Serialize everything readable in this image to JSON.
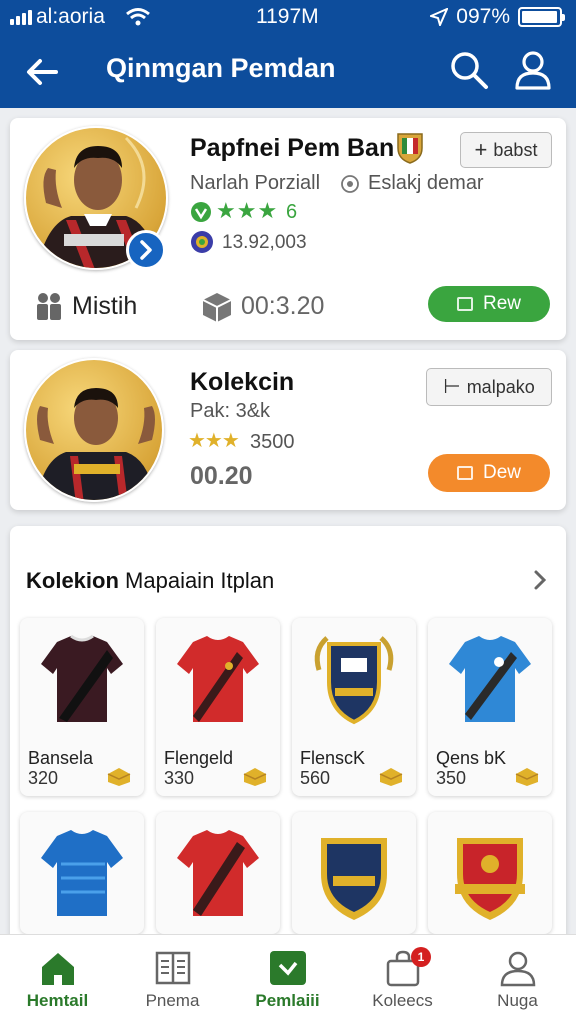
{
  "status_bar": {
    "carrier": "al:aoria",
    "time": "1197M",
    "battery": "097%",
    "battery_level": 0.97
  },
  "app_bar": {
    "title": "Qinmgan Pemdan"
  },
  "player_card": {
    "name": "Papfnei Pem Ban",
    "subtitle": "Narlah Porziall",
    "tag": "Eslakj demar",
    "rating": "6",
    "stars": 3,
    "coins": "13.92,003",
    "action_label": "babst",
    "stat1_label": "Mistih",
    "stat2_value": "00:3.20",
    "primary_label": "Rew",
    "primary_color": "#3aa53f"
  },
  "collection_card": {
    "name": "Kolekcin",
    "subtitle": "Pak: 3&k",
    "stars": 3,
    "points": "3500",
    "time": "00.20",
    "action_label": "malpako",
    "primary_label": "Dew",
    "primary_color": "#f38a2b"
  },
  "section": {
    "title_bold": "Kolekion",
    "title_rest": "Mapaiain Itplan",
    "items": [
      {
        "name": "Bansela",
        "price": "320",
        "icon": "jersey-maroon"
      },
      {
        "name": "Flengeld",
        "price": "330",
        "icon": "jersey-red"
      },
      {
        "name": "FlenscK",
        "price": "560",
        "icon": "shield-crest"
      },
      {
        "name": "Qens bK",
        "price": "350",
        "icon": "jersey-blue"
      },
      {
        "icon": "jersey-blue-stripes"
      },
      {
        "icon": "jersey-red-sash"
      },
      {
        "icon": "shield-navy-gold"
      },
      {
        "icon": "shield-red-gold"
      }
    ]
  },
  "bottom_nav": [
    {
      "label": "Hemtail",
      "icon": "home-icon",
      "active": true
    },
    {
      "label": "Pnema",
      "icon": "book-icon",
      "active": false
    },
    {
      "label": "Pemlaiii",
      "icon": "check-box-icon",
      "active": true
    },
    {
      "label": "Koleecs",
      "icon": "bag-icon",
      "badge": "1",
      "active": false
    },
    {
      "label": "Nuga",
      "icon": "profile-icon",
      "active": false
    }
  ],
  "colors": {
    "primary_blue": "#0d4d9c",
    "green": "#3aa53f",
    "orange": "#f38a2b",
    "gold": "#e0b12a"
  }
}
